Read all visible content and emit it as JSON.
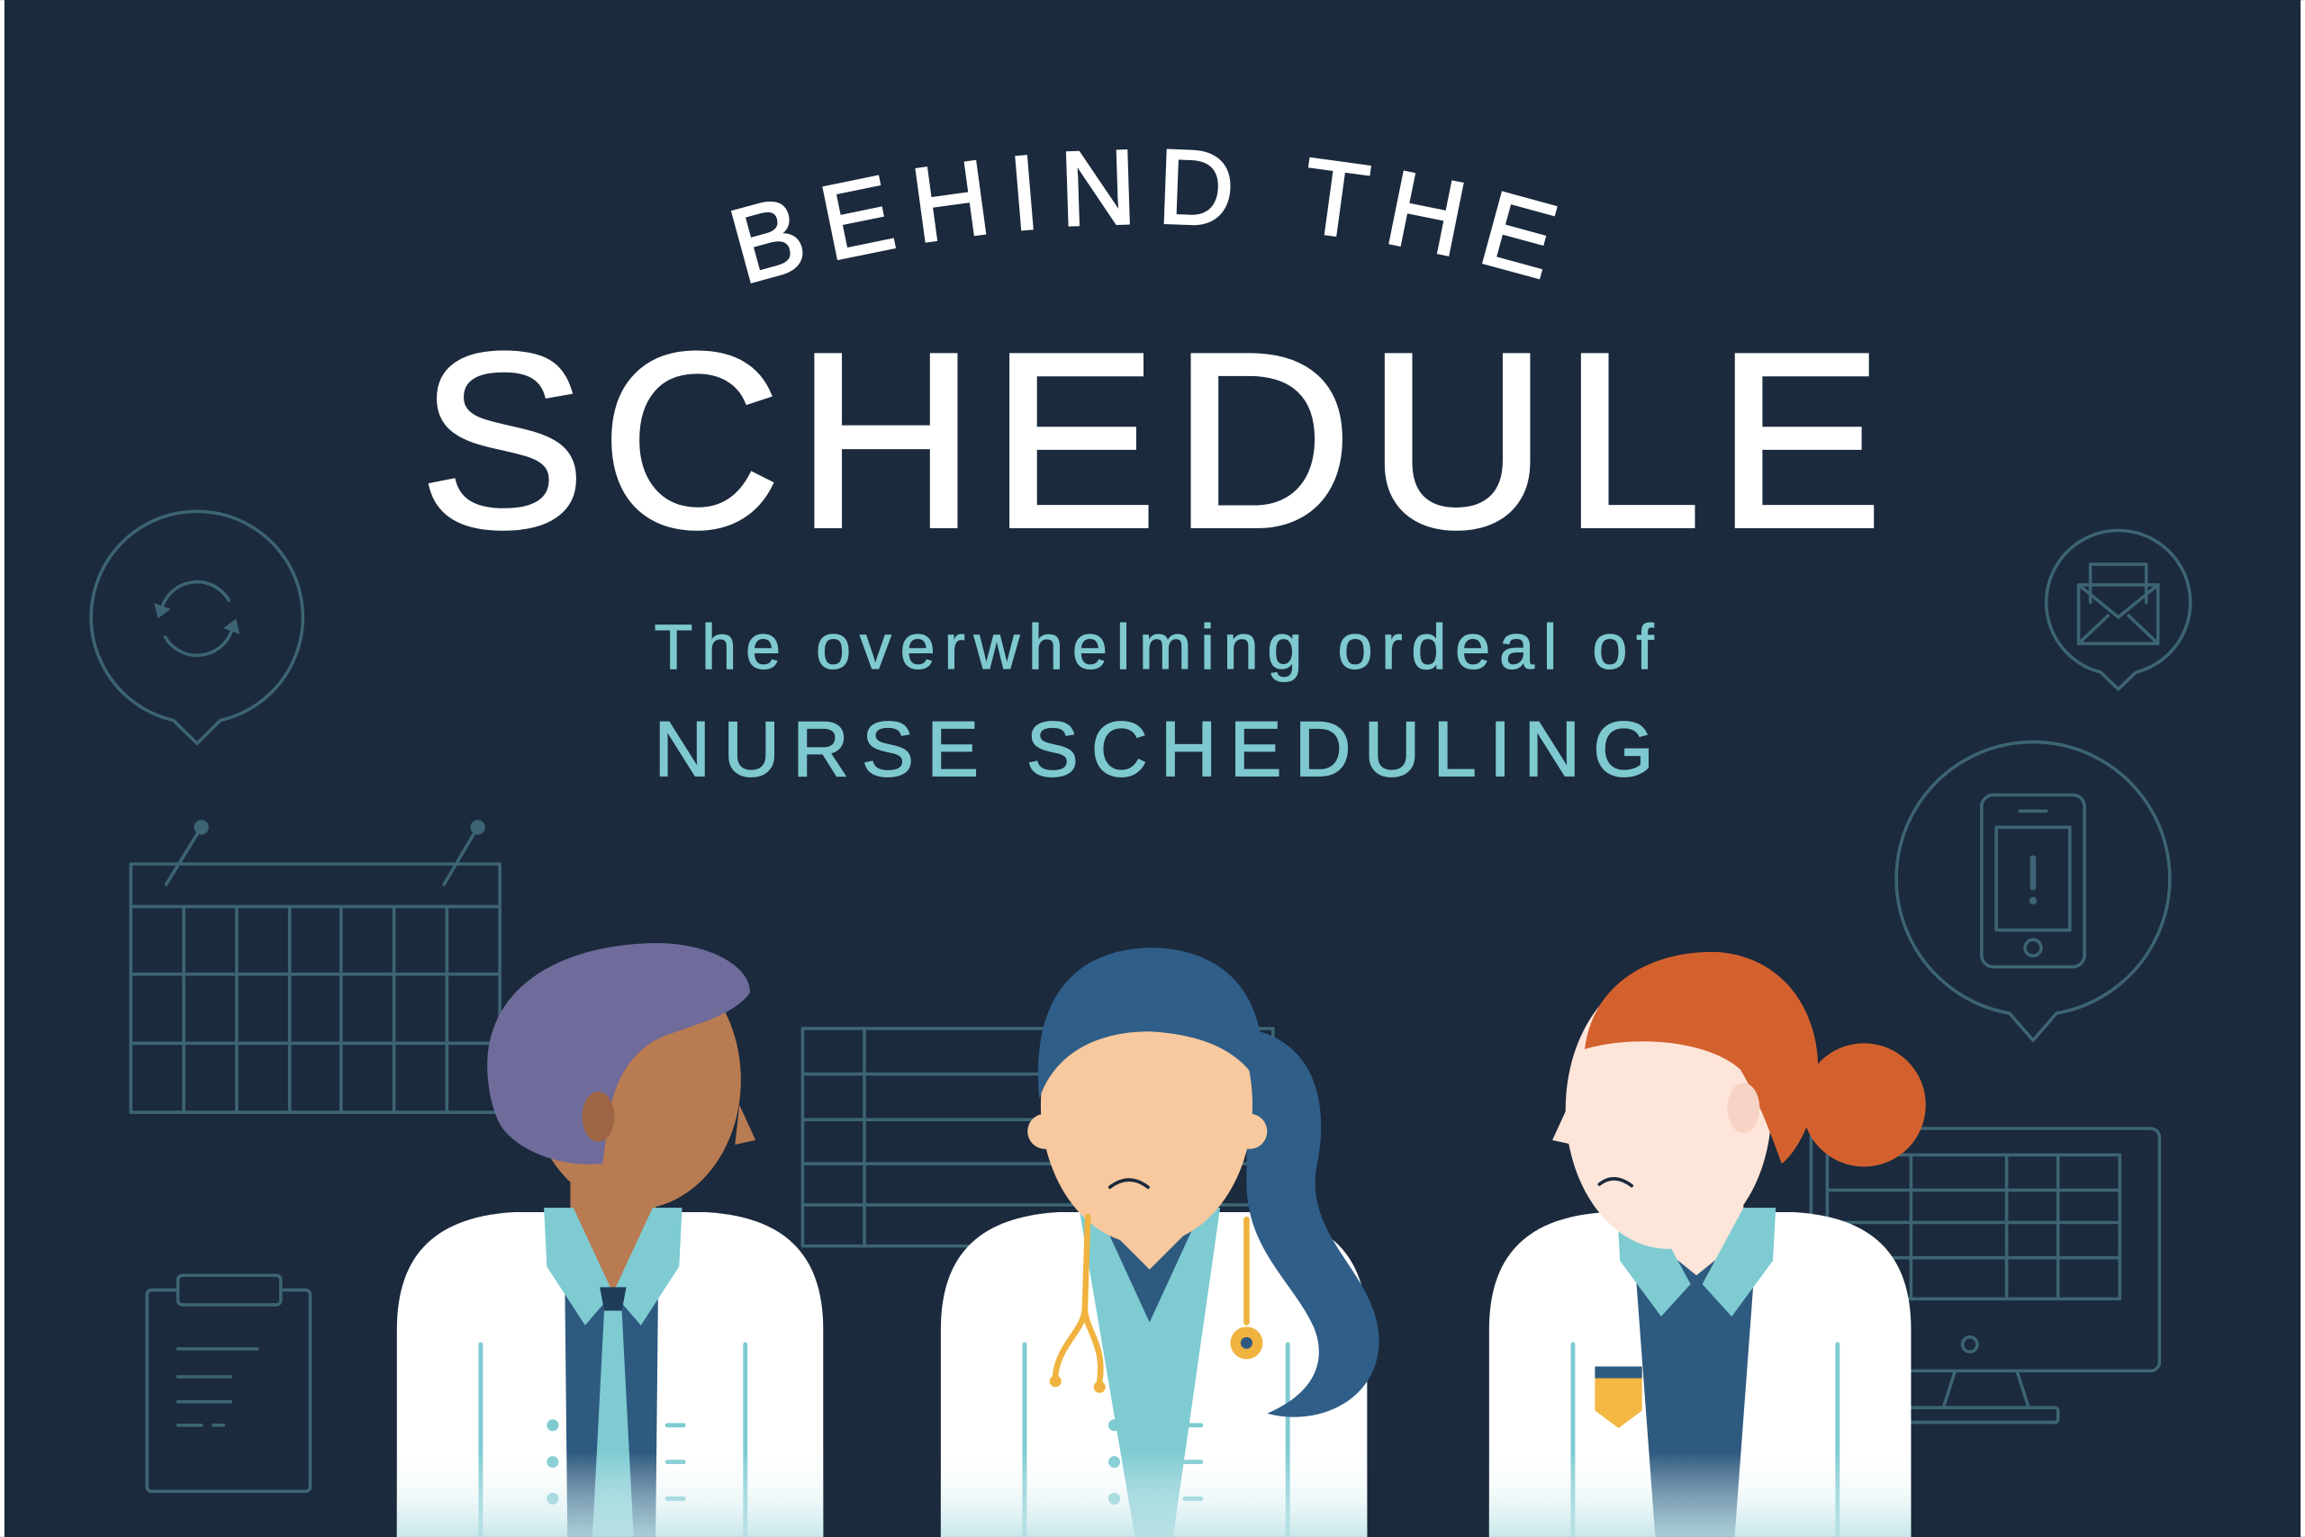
{
  "header": {
    "title_line1": "BEHIND THE",
    "title_line2": "SCHEDULE",
    "subtitle_line1": "The overwhelming ordeal of",
    "subtitle_line2": "NURSE SCHEDULING"
  },
  "colors": {
    "background": "#1b2a3d",
    "title": "#ffffff",
    "subtitle": "#7ec9cf",
    "icon_stroke": "#3d6474",
    "coat": "#ffffff",
    "coat_trim": "#7ecbd2",
    "scrub_navy": "#2e5a80",
    "hair_purple": "#6f6b9a",
    "skin_brown": "#b97b52",
    "hair_blue": "#2f5e88",
    "skin_peach": "#f8c89e",
    "stethoscope": "#f0b33f",
    "hair_red": "#d3612e",
    "skin_pale": "#fde5d9",
    "badge": "#f4b743"
  },
  "icons": {
    "refresh": "refresh-icon",
    "calendar": "calendar-icon",
    "clipboard": "clipboard-icon",
    "table": "table-icon",
    "envelope": "envelope-icon",
    "phone": "phone-alert-icon",
    "monitor": "monitor-icon"
  }
}
